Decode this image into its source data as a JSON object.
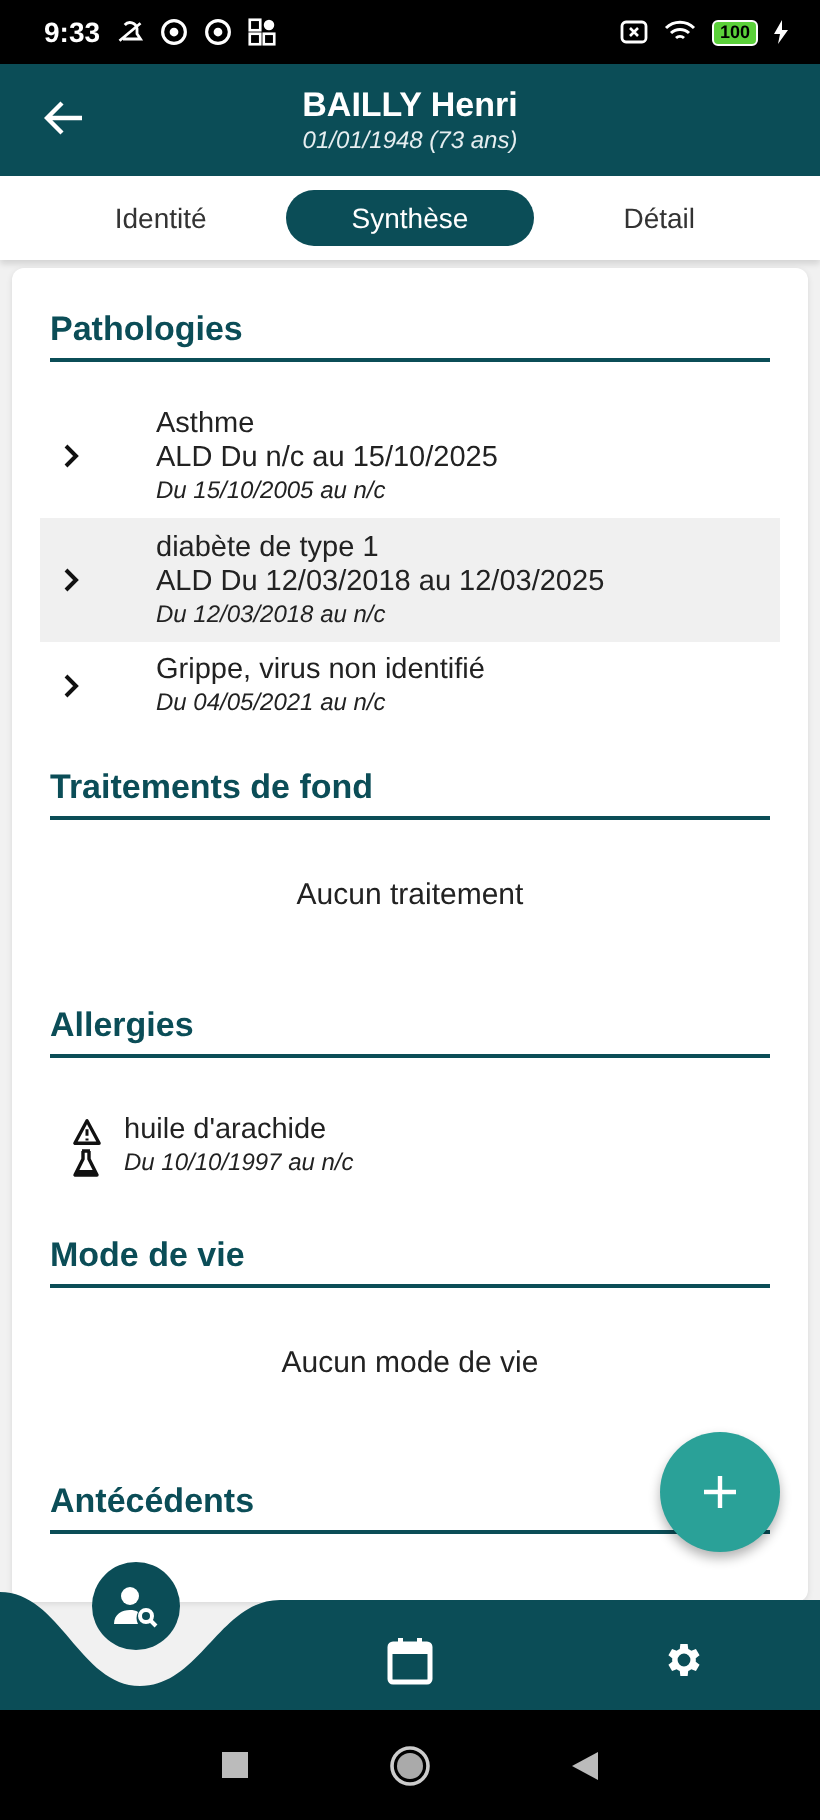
{
  "status_bar": {
    "time": "9:33",
    "battery": "100"
  },
  "header": {
    "title": "BAILLY Henri",
    "subtitle": "01/01/1948 (73 ans)"
  },
  "tabs": [
    {
      "label": "Identité",
      "selected": false
    },
    {
      "label": "Synthèse",
      "selected": true
    },
    {
      "label": "Détail",
      "selected": false
    }
  ],
  "sections": [
    {
      "title": "Pathologies",
      "kind": "pathologies",
      "items": [
        {
          "name": "Asthme",
          "ald": "ALD Du n/c au 15/10/2025",
          "period": "Du 15/10/2005 au n/c",
          "selected": false
        },
        {
          "name": "diabète de type 1",
          "ald": "ALD Du 12/03/2018 au 12/03/2025",
          "period": "Du 12/03/2018 au n/c",
          "selected": true
        },
        {
          "name": "Grippe, virus non identifié",
          "period": "Du 04/05/2021 au n/c",
          "selected": false
        }
      ]
    },
    {
      "title": "Traitements de fond",
      "kind": "message",
      "message": "Aucun traitement"
    },
    {
      "title": "Allergies",
      "kind": "allergies",
      "items": [
        {
          "name": "huile d'arachide",
          "period": "Du 10/10/1997 au n/c"
        }
      ]
    },
    {
      "title": "Mode de vie",
      "kind": "message",
      "message": "Aucun mode de vie"
    },
    {
      "title": "Antécédents"
    }
  ],
  "bottom_nav": [
    {
      "kind": "patient-search",
      "selected": true
    },
    {
      "kind": "calendar",
      "selected": false
    },
    {
      "kind": "settings",
      "selected": false
    }
  ]
}
